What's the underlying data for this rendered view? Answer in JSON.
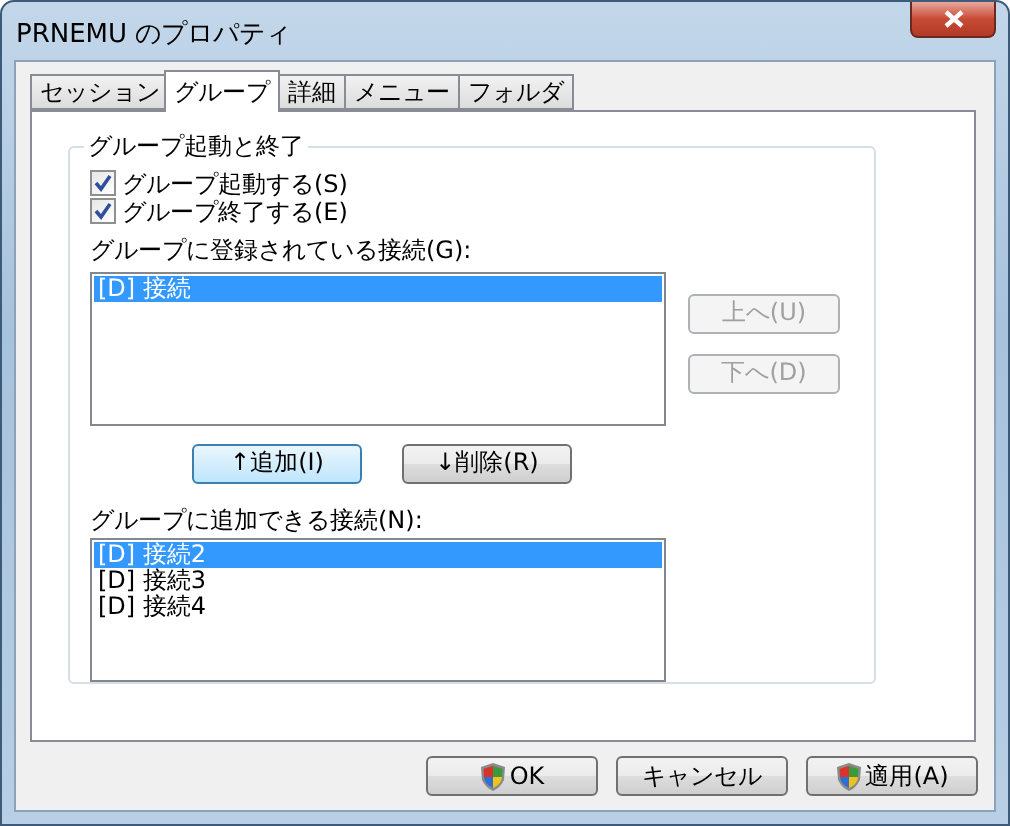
{
  "window": {
    "title": "PRNEMU のプロパティ"
  },
  "tabs": [
    {
      "label": "セッション",
      "selected": false
    },
    {
      "label": "グループ",
      "selected": true
    },
    {
      "label": "詳細",
      "selected": false
    },
    {
      "label": "メニュー",
      "selected": false
    },
    {
      "label": "フォルダ",
      "selected": false
    }
  ],
  "group": {
    "title": "グループ起動と終了",
    "checkboxes": [
      {
        "label": "グループ起動する(S)",
        "checked": true
      },
      {
        "label": "グループ終了する(E)",
        "checked": true
      }
    ],
    "registered_label": "グループに登録されている接続(G):",
    "registered": [
      {
        "label": "[D] 接続",
        "selected": true
      }
    ],
    "move_buttons": [
      {
        "label": "上へ(U)",
        "disabled": true
      },
      {
        "label": "下へ(D)",
        "disabled": true
      }
    ],
    "transfer_buttons": [
      {
        "label": "↑追加(I)",
        "focused": true
      },
      {
        "label": "↓削除(R)",
        "focused": false
      }
    ],
    "available_label": "グループに追加できる接続(N):",
    "available": [
      {
        "label": "[D] 接続2",
        "selected": true
      },
      {
        "label": "[D] 接続3",
        "selected": false
      },
      {
        "label": "[D] 接続4",
        "selected": false
      }
    ]
  },
  "buttons": [
    {
      "label": "OK",
      "shield": true
    },
    {
      "label": "キャンセル",
      "shield": false
    },
    {
      "label": "適用(A)",
      "shield": true
    }
  ]
}
